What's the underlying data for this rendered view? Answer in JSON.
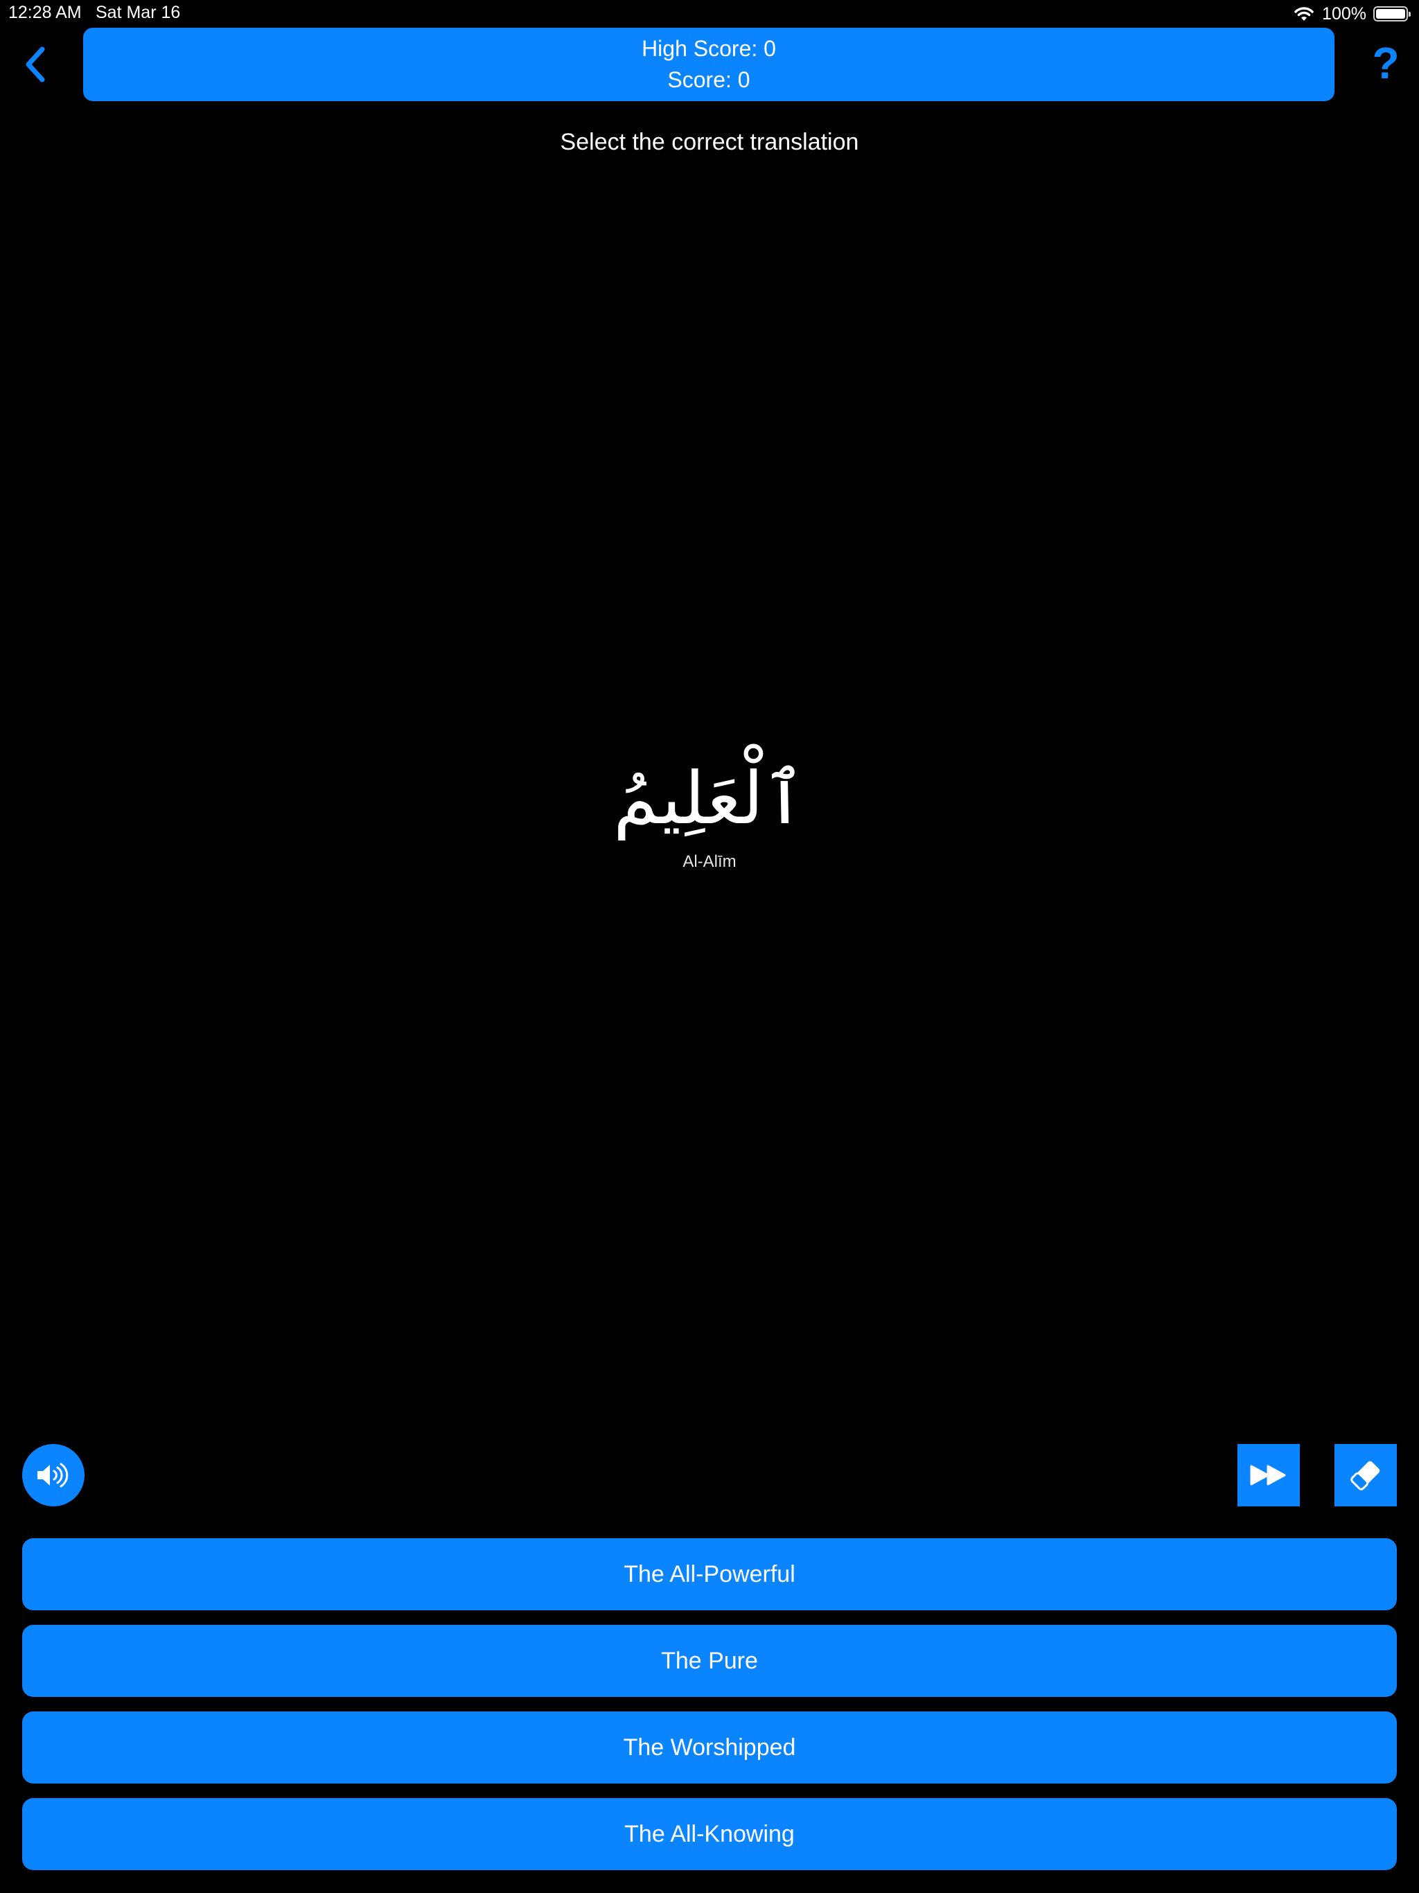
{
  "status_bar": {
    "time": "12:28 AM",
    "date": "Sat Mar 16",
    "battery": "100%"
  },
  "header": {
    "back_icon": "chevron-left-icon",
    "help_label": "?",
    "high_score": "High Score: 0",
    "score": "Score: 0"
  },
  "prompt": "Select the correct translation",
  "question": {
    "arabic": "ٱلْعَلِيمُ",
    "transliteration": "Al-Alīm"
  },
  "controls": {
    "sound_icon": "speaker-icon",
    "skip_icon": "fast-forward-icon",
    "erase_icon": "eraser-icon"
  },
  "answers": [
    "The All-Powerful",
    "The Pure",
    "The Worshipped",
    "The All-Knowing"
  ],
  "colors": {
    "accent": "#0a84ff",
    "background": "#000000",
    "text": "#ffffff"
  }
}
